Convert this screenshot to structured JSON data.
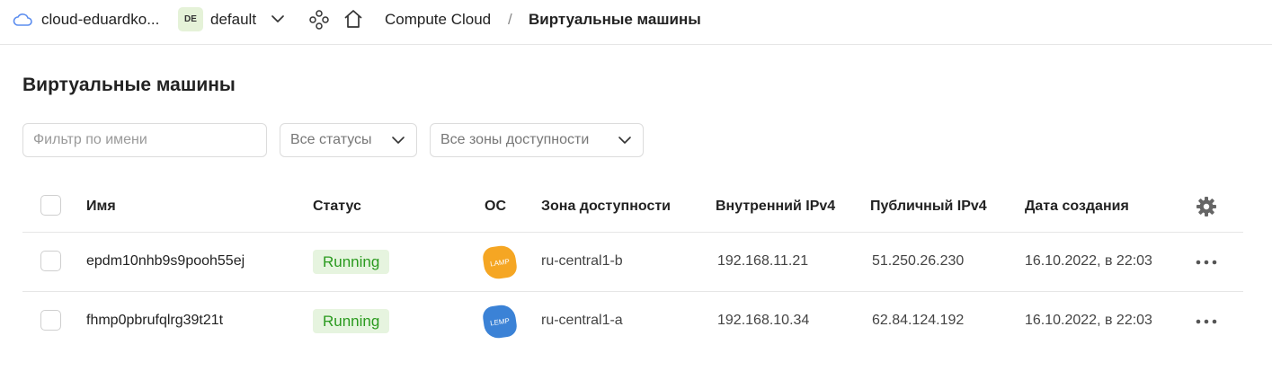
{
  "header": {
    "cloud_name": "cloud-eduardko...",
    "folder_badge": "DE",
    "folder_name": "default",
    "breadcrumb_service": "Compute Cloud",
    "breadcrumb_separator": "/",
    "breadcrumb_current": "Виртуальные машины"
  },
  "page": {
    "title": "Виртуальные машины"
  },
  "filters": {
    "name_placeholder": "Фильтр по имени",
    "status_value": "Все статусы",
    "zone_value": "Все зоны доступности"
  },
  "table": {
    "columns": {
      "name": "Имя",
      "status": "Статус",
      "os": "ОС",
      "zone": "Зона доступности",
      "internal_ip": "Внутренний IPv4",
      "public_ip": "Публичный IPv4",
      "created": "Дата создания"
    },
    "rows": [
      {
        "name": "epdm10nhb9s9pooh55ej",
        "status": "Running",
        "os_label": "LAMP",
        "os_color": "#f5a623",
        "zone": "ru-central1-b",
        "internal_ip": "192.168.11.21",
        "public_ip": "51.250.26.230",
        "created": "16.10.2022, в 22:03"
      },
      {
        "name": "fhmp0pbrufqlrg39t21t",
        "status": "Running",
        "os_label": "LEMP",
        "os_color": "#3b82d6",
        "zone": "ru-central1-a",
        "internal_ip": "192.168.10.34",
        "public_ip": "62.84.124.192",
        "created": "16.10.2022, в 22:03"
      }
    ]
  },
  "colors": {
    "status_running_bg": "#e6f4df",
    "status_running_text": "#2a9a1e",
    "cloud_icon": "#5b8def",
    "folder_badge_bg": "#e5f2d8"
  },
  "icons": {
    "cloud": "cloud-icon",
    "folder_dropdown": "chevron-down-icon",
    "services": "services-icon",
    "home": "home-icon",
    "settings": "gear-icon",
    "row_actions": "more-horizontal-icon"
  }
}
